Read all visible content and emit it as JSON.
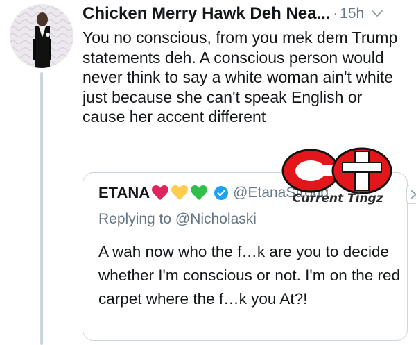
{
  "tweet": {
    "display_name": "Chicken Merry Hawk Deh Nea...",
    "separator": "·",
    "time": "15h",
    "text": "You no conscious, from you mek dem Trump statements deh. A conscious person would never think to say a white woman ain't white just because she can't speak English or cause her accent different"
  },
  "quoted_tweet": {
    "display_name": "ETANA",
    "handle": "@EtanaStrong",
    "replying_to": "Replying to @Nicholaski",
    "text": "A wah now who the f…k are you to decide whether I'm conscious or not. I'm on the red carpet where the f…k you At?!",
    "hearts": [
      "#e0245e",
      "#ffcc4d",
      "#2fbf4a"
    ]
  },
  "watermark": {
    "logo_letters": "CT",
    "label": "Current Tingz"
  },
  "colors": {
    "text": "#14171a",
    "secondary": "#657786",
    "border": "#ccd6dd",
    "verified": "#1da1f2",
    "logo_red": "#e3161b"
  },
  "icons": [
    "chevron-down-icon",
    "verified-badge-icon",
    "heart-icon",
    "chevron-right-icon"
  ]
}
